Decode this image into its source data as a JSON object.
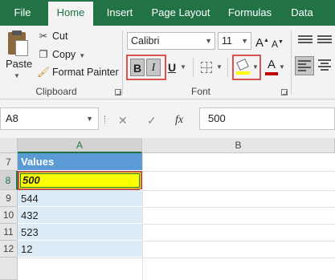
{
  "ribbon_tabs": [
    {
      "label": "File"
    },
    {
      "label": "Home"
    },
    {
      "label": "Insert"
    },
    {
      "label": "Page Layout"
    },
    {
      "label": "Formulas"
    },
    {
      "label": "Data"
    }
  ],
  "clipboard": {
    "paste_label": "Paste",
    "cut_label": "Cut",
    "copy_label": "Copy",
    "format_painter_label": "Format Painter",
    "group_label": "Clipboard"
  },
  "font": {
    "font_name": "Calibri",
    "font_size": "11",
    "bold_glyph": "B",
    "italic_glyph": "I",
    "underline_glyph": "U",
    "font_color_glyph": "A",
    "grow_glyph": "A",
    "shrink_glyph": "A",
    "group_label": "Font"
  },
  "colors": {
    "ribbon_green": "#217346",
    "highlight_yellow": "#ffff00",
    "font_color_red": "#c00000",
    "header_blue": "#5b9bd5",
    "band_blue": "#ddebf7",
    "callout_red": "#d9534f"
  },
  "formula_bar": {
    "name_box": "A8",
    "cancel_glyph": "✕",
    "enter_glyph": "✓",
    "fx_glyph": "fx",
    "formula_value": "500"
  },
  "grid": {
    "columns": [
      "A",
      "B"
    ],
    "rows": [
      {
        "num": "7",
        "value": "Values"
      },
      {
        "num": "8",
        "value": "500"
      },
      {
        "num": "9",
        "value": "544"
      },
      {
        "num": "10",
        "value": "432"
      },
      {
        "num": "11",
        "value": "523"
      },
      {
        "num": "12",
        "value": "12"
      }
    ]
  }
}
